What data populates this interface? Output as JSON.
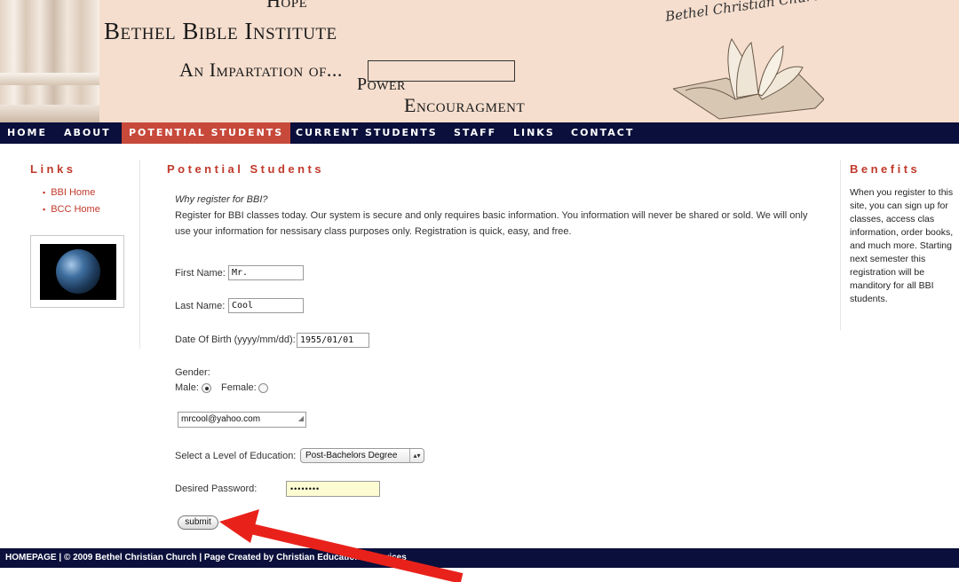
{
  "header": {
    "hope_text": "Hope",
    "site_title": "Bethel Bible Institute",
    "impart_text": "An Impartation of...",
    "power_text": "Power",
    "encourage_text": "Encouragment",
    "church_script": "Bethel Christian Church"
  },
  "nav": {
    "items": [
      "HOME",
      "ABOUT",
      "POTENTIAL STUDENTS",
      "CURRENT STUDENTS",
      "STAFF",
      "LINKS",
      "CONTACT"
    ],
    "active": "POTENTIAL STUDENTS"
  },
  "left": {
    "title": "Links",
    "links": [
      "BBI Home",
      "BCC Home"
    ]
  },
  "main": {
    "title": "Potential Students",
    "why": "Why register for BBI?",
    "intro": "Register for BBI classes today. Our system is secure and only requires basic information. You information will never be shared or sold. We will only use your information for nessisary class purposes only. Registration is quick, easy, and free.",
    "first_name_label": "First Name:",
    "first_name_value": "Mr.",
    "last_name_label": "Last Name:",
    "last_name_value": "Cool",
    "dob_label": "Date Of Birth (yyyy/mm/dd):",
    "dob_value": "1955/01/01",
    "gender_label": "Gender:",
    "male_label": "Male:",
    "female_label": "Female:",
    "gender_selected": "Male",
    "email_value": "mrcool@yahoo.com",
    "education_label": "Select a Level of Education:",
    "education_value": "Post-Bachelors Degree",
    "password_label": "Desired Password:",
    "password_value": "••••••••",
    "submit_label": "submit"
  },
  "right": {
    "title": "Benefits",
    "text": "When you register to this site, you can sign up for classes, access clas information, order books, and much more. Starting next semester this registration will be manditory for all BBI students."
  },
  "footer": {
    "text": "HOMEPAGE | © 2009 Bethel Christian Church | Page Created by Christian Educational Services"
  },
  "colors": {
    "header_bg": "#f5dece",
    "nav_bg": "#0a0f3b",
    "accent": "#c0392b",
    "annotation_arrow": "#e8221b"
  }
}
